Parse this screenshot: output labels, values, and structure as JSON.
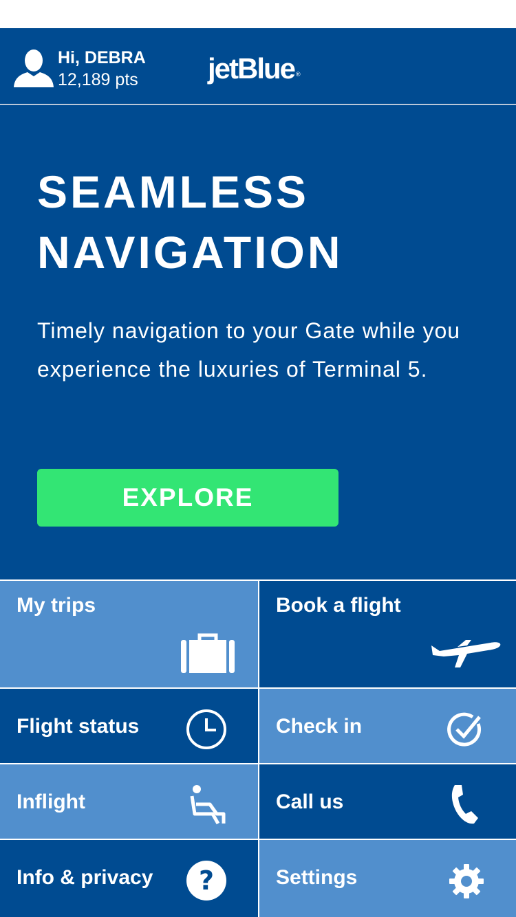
{
  "header": {
    "greeting": "Hi, DEBRA",
    "points": "12,189 pts",
    "brand": "jetBlue",
    "brand_mark": "®",
    "avatar_icon": "user-silhouette-icon"
  },
  "hero": {
    "title_line1": "SEAMLESS",
    "title_line2": "NAVIGATION",
    "description": "Timely navigation to your Gate while you experience the luxuries of Terminal 5.",
    "cta_label": "EXPLORE"
  },
  "menu": {
    "my_trips": {
      "label": "My trips",
      "icon": "suitcase-icon"
    },
    "book_flight": {
      "label": "Book a flight",
      "icon": "airplane-icon"
    },
    "flight_status": {
      "label": "Flight status",
      "icon": "clock-icon"
    },
    "check_in": {
      "label": "Check in",
      "icon": "checkmark-circle-icon"
    },
    "inflight": {
      "label": "Inflight",
      "icon": "seat-icon"
    },
    "call_us": {
      "label": "Call us",
      "icon": "phone-icon"
    },
    "info_privacy": {
      "label": "Info & privacy",
      "icon": "question-icon"
    },
    "settings": {
      "label": "Settings",
      "icon": "gear-icon"
    }
  },
  "colors": {
    "brand_blue": "#004b91",
    "light_blue": "#518fcd",
    "cta_green": "#33e574"
  }
}
